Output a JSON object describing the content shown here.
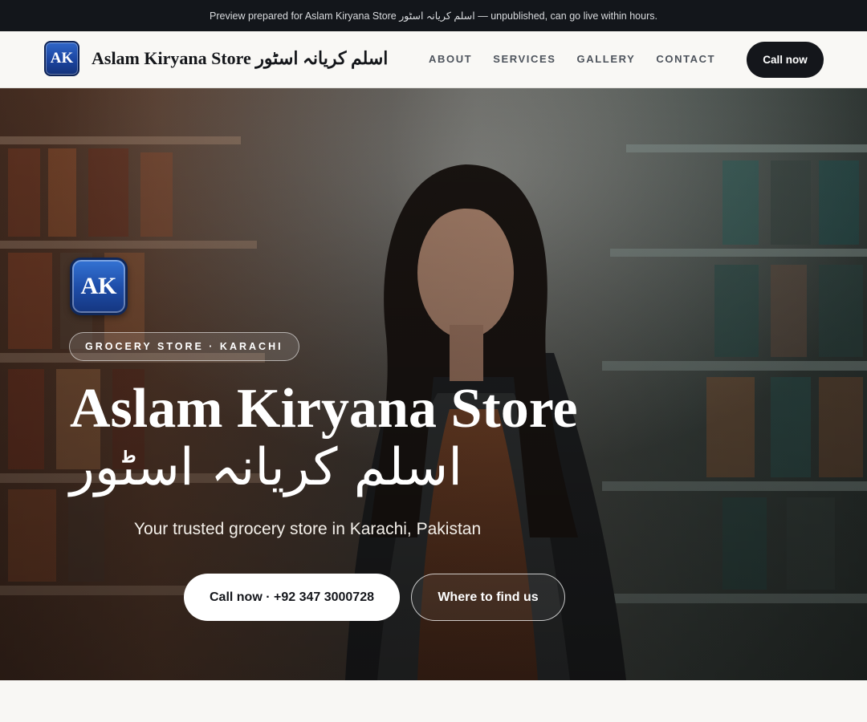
{
  "preview_banner": {
    "text": "Preview prepared for Aslam Kiryana Store اسلم کریانہ اسٹور — unpublished, can go live within hours."
  },
  "header": {
    "logo_initials": "AK",
    "brand_name": "Aslam Kiryana Store اسلم کریانہ اسٹور",
    "nav_items": [
      "ABOUT",
      "SERVICES",
      "GALLERY",
      "CONTACT"
    ],
    "cta_label": "Call now"
  },
  "hero": {
    "logo_initials": "AK",
    "category_pill": "GROCERY STORE · KARACHI",
    "title_en": "Aslam Kiryana Store",
    "title_ur": "اسلم کریانہ اسٹور",
    "tagline": "Your trusted grocery store in Karachi, Pakistan",
    "primary_button": "Call now · +92 347 3000728",
    "secondary_button": "Where to find us",
    "background_image": "woman-in-grocery-aisle-photo"
  },
  "colors": {
    "dark": "#13161b",
    "badge_blue": "#1d4ba6",
    "page_bg": "#f8f7f4"
  }
}
